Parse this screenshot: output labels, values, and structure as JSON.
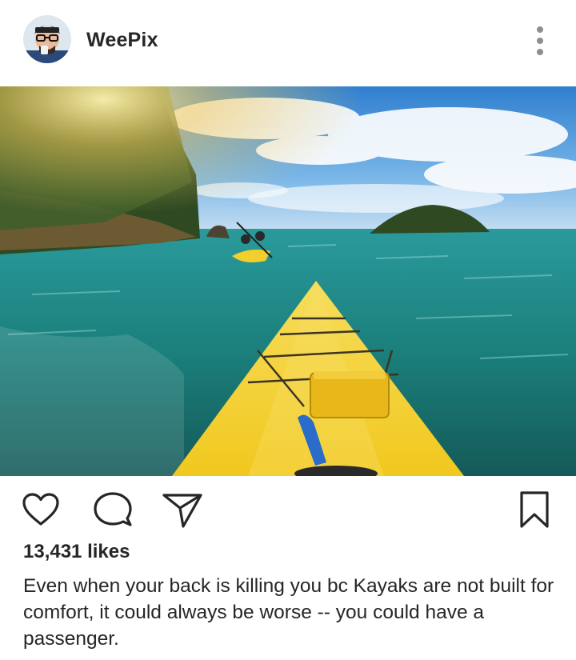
{
  "post": {
    "username": "WeePix",
    "likes": "13,431 likes",
    "caption": "Even when your back is killing you bc Kayaks are not built for comfort, it could always be worse -- you could have a passenger."
  },
  "icons": {
    "more": "more-vertical-icon",
    "like": "heart-icon",
    "comment": "comment-icon",
    "share": "send-icon",
    "save": "bookmark-icon"
  },
  "colors": {
    "text": "#262626",
    "icon": "#262626",
    "muted": "#8e8e8e",
    "kayak": "#f2cf2a",
    "sea": "#1f8f8c",
    "sky": "#3f8fd6"
  }
}
